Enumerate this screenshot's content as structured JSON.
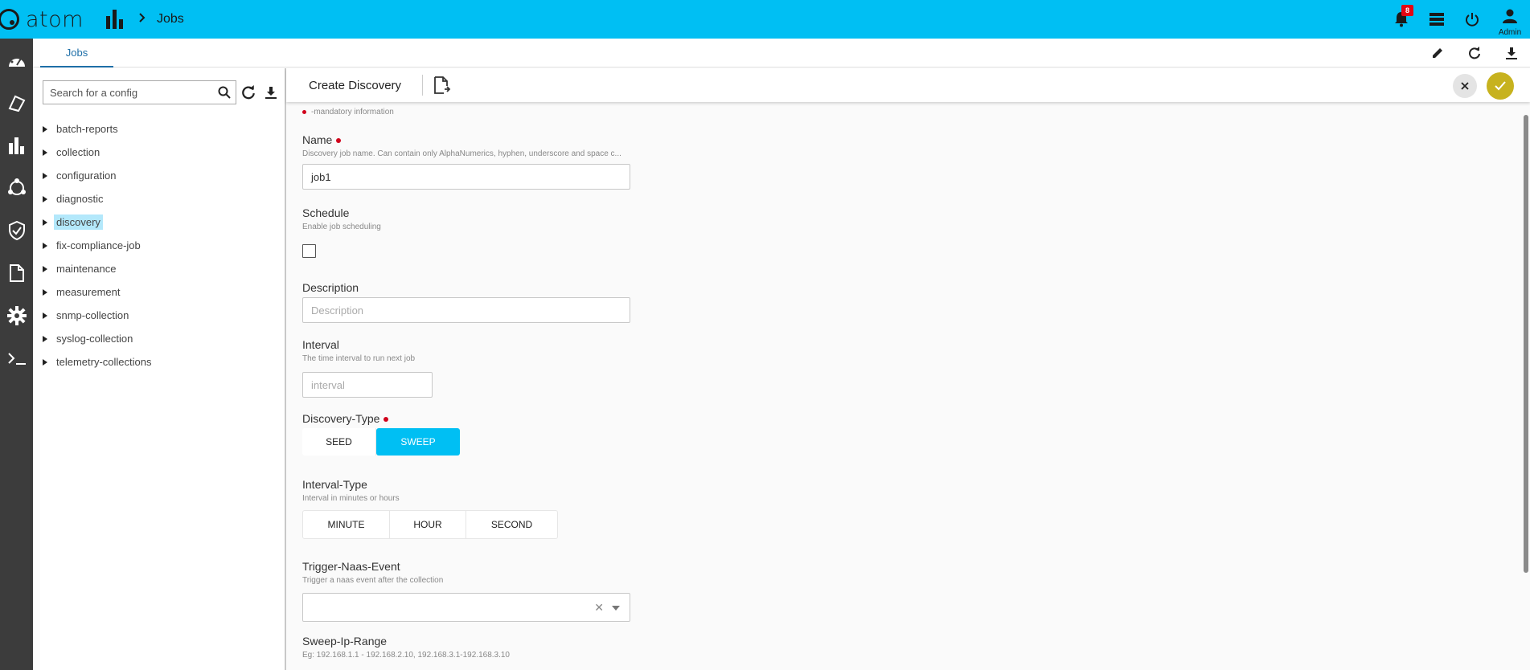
{
  "app": {
    "logo_text": "atom",
    "breadcrumb_title": "Jobs",
    "notification_count": "8",
    "user_label": "Admin"
  },
  "icons": {
    "topbar": [
      "analytics-icon",
      "chevron-right-icon",
      "bell-icon",
      "list-icon",
      "power-icon",
      "user-icon"
    ],
    "rail": [
      "dashboard-icon",
      "resources-icon",
      "analytics-icon",
      "topology-icon",
      "shield-icon",
      "document-icon",
      "gear-icon",
      "terminal-icon"
    ],
    "tab_actions": [
      "pencil-icon",
      "refresh-icon",
      "download-icon"
    ]
  },
  "tabs": [
    {
      "label": "Jobs"
    }
  ],
  "tree_panel": {
    "search_placeholder": "Search for a config",
    "items": [
      {
        "label": "batch-reports",
        "selected": false
      },
      {
        "label": "collection",
        "selected": false
      },
      {
        "label": "configuration",
        "selected": false
      },
      {
        "label": "diagnostic",
        "selected": false
      },
      {
        "label": "discovery",
        "selected": true
      },
      {
        "label": "fix-compliance-job",
        "selected": false
      },
      {
        "label": "maintenance",
        "selected": false
      },
      {
        "label": "measurement",
        "selected": false
      },
      {
        "label": "snmp-collection",
        "selected": false
      },
      {
        "label": "syslog-collection",
        "selected": false
      },
      {
        "label": "telemetry-collections",
        "selected": false
      }
    ]
  },
  "form": {
    "title": "Create Discovery",
    "mandatory_note": "-mandatory information",
    "name": {
      "label": "Name",
      "help": "Discovery job name. Can contain only AlphaNumerics, hyphen, underscore and space c...",
      "value": "job1"
    },
    "schedule": {
      "label": "Schedule",
      "help": "Enable job scheduling",
      "checked": false
    },
    "description": {
      "label": "Description",
      "placeholder": "Description"
    },
    "interval": {
      "label": "Interval",
      "help": "The time interval to run next job",
      "placeholder": "interval"
    },
    "discovery_type": {
      "label": "Discovery-Type",
      "options": [
        "SEED",
        "SWEEP"
      ],
      "selected": "SWEEP"
    },
    "interval_type": {
      "label": "Interval-Type",
      "help": "Interval in minutes or hours",
      "options": [
        "MINUTE",
        "HOUR",
        "SECOND"
      ]
    },
    "trigger_naas_event": {
      "label": "Trigger-Naas-Event",
      "help": "Trigger a naas event after the collection",
      "clear_symbol": "✕"
    },
    "sweep_ip_range": {
      "label": "Sweep-Ip-Range",
      "help": "Eg: 192.168.1.1 - 192.168.2.10, 192.168.3.1-192.168.3.10"
    }
  },
  "colors": {
    "topbar": "#00bff3",
    "rail": "#3c3c3c",
    "accent_tab": "#1e6fa8",
    "selected_segment": "#00bff3",
    "confirm_button": "#c7b21e",
    "mandatory_dot": "#d0021b",
    "badge": "#e30613"
  }
}
